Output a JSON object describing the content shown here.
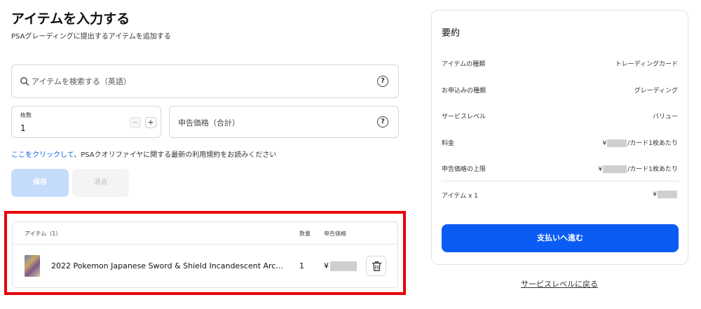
{
  "header": {
    "title": "アイテムを入力する",
    "subtitle": "PSAグレーディングに提出するアイテムを追加する"
  },
  "search": {
    "placeholder": "アイテムを検索する（英語）"
  },
  "quantity": {
    "label": "枚数",
    "value": "1",
    "minus": "−",
    "plus": "+"
  },
  "declared_value": {
    "label": "申告価格（合計）"
  },
  "help_glyph": "?",
  "terms": {
    "link_text": "ここをクリックして",
    "rest_text": "、PSAクオリファイヤに関する最新の利用規約をお読みください"
  },
  "actions": {
    "save_label": "保存",
    "clear_label": "消去"
  },
  "items_table": {
    "header_item": "アイテム（1）",
    "header_qty": "数量",
    "header_price": "申告価格",
    "rows": [
      {
        "name": "2022 Pokemon Japanese Sword & Shield Incandescent Arc...",
        "qty": "1",
        "currency": "¥"
      }
    ]
  },
  "summary": {
    "title": "要約",
    "rows": [
      {
        "label": "アイテムの種類",
        "value": "トレーディングカード"
      },
      {
        "label": "お申込みの種類",
        "value": "グレーディング"
      },
      {
        "label": "サービスレベル",
        "value": "バリュー"
      },
      {
        "label": "料金",
        "currency": "¥",
        "suffix": "/カード1枚あたり"
      },
      {
        "label": "申告価格の上限",
        "currency": "¥",
        "suffix": "/カード1枚あたり"
      },
      {
        "label": "アイテム x 1",
        "currency": "¥"
      }
    ],
    "checkout_label": "支払いへ進む"
  },
  "back_link": "サービスレベルに戻る",
  "colors": {
    "accent": "#0a5cf5",
    "link": "#0a5fe8",
    "highlight": "#e8000b"
  }
}
